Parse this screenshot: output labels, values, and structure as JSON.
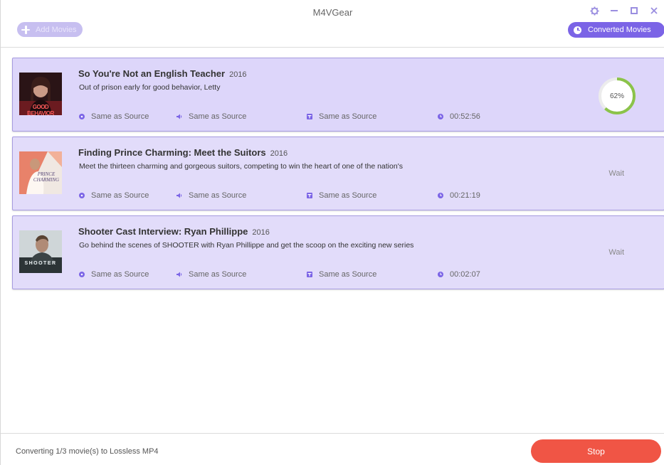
{
  "app": {
    "title": "M4VGear"
  },
  "toolbar": {
    "add_movies_label": "Add Movies",
    "converted_movies_label": "Converted Movies"
  },
  "colors": {
    "accent": "#7b64e6",
    "item_bg": "#e2dcfa",
    "progress": "#8bc34a",
    "stop": "#f05545"
  },
  "items": [
    {
      "title": "So You're Not an English Teacher",
      "year": "2016",
      "description": "Out of prison early for good behavior, Letty",
      "video": "Same as Source",
      "audio": "Same as Source",
      "subtitle": "Same as Source",
      "duration": "00:52:56",
      "status": "62%",
      "progress": 0.62,
      "thumb_text": "GOOD BEHAVIOR"
    },
    {
      "title": "Finding Prince Charming: Meet the Suitors",
      "year": "2016",
      "description": "Meet the thirteen charming and gorgeous suitors, competing to win the heart of one of the nation's",
      "video": "Same as Source",
      "audio": "Same as Source",
      "subtitle": "Same as Source",
      "duration": "00:21:19",
      "status": "Wait",
      "thumb_text": "PRINCE CHARMING"
    },
    {
      "title": "Shooter Cast Interview: Ryan Phillippe",
      "year": "2016",
      "description": "Go behind the scenes of SHOOTER with Ryan Phillippe and get the scoop on the exciting new series",
      "video": "Same as Source",
      "audio": "Same as Source",
      "subtitle": "Same as Source",
      "duration": "00:02:07",
      "status": "Wait",
      "thumb_text": "SHOOTER"
    }
  ],
  "footer": {
    "status_text": "Converting 1/3 movie(s) to Lossless MP4",
    "stop_label": "Stop"
  }
}
